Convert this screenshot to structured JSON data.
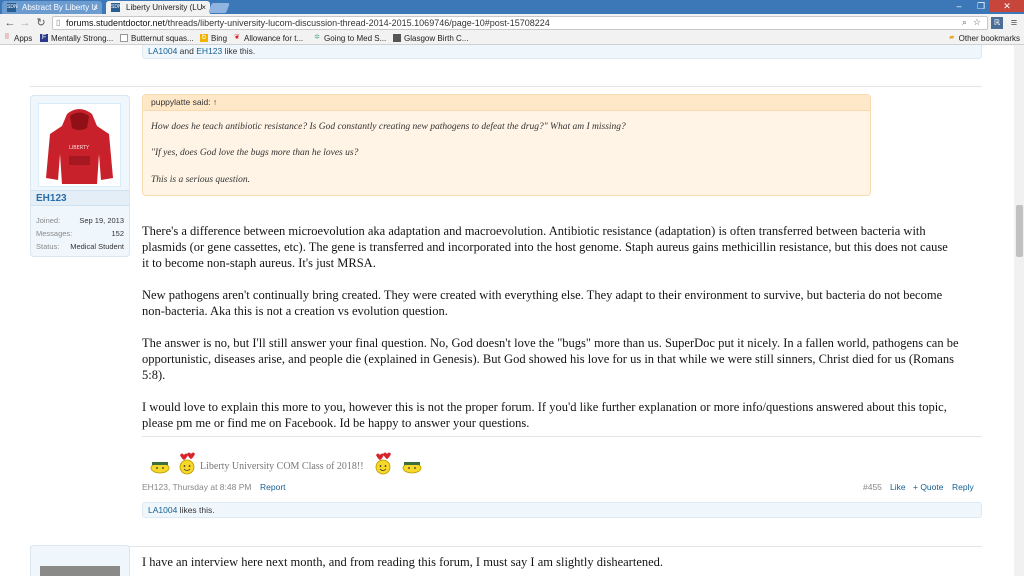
{
  "browser": {
    "tabs": [
      {
        "label": "Abstract By Liberty U",
        "active": false
      },
      {
        "label": "Liberty University (LU",
        "active": true
      }
    ],
    "url_prefix": "forums.studentdoctor.net",
    "url_path": "/threads/liberty-university-lucom-discussion-thread-2014-2015.1069746/page-10#post-15708224",
    "bookmarks": [
      {
        "label": "Apps",
        "icon": "apps-grid-icon"
      },
      {
        "label": "Mentally Strong...",
        "icon": "f-icon"
      },
      {
        "label": "Butternut squas...",
        "icon": "page-icon"
      },
      {
        "label": "Bing",
        "icon": "bing-icon"
      },
      {
        "label": "Allowance for t...",
        "icon": "leaf-icon"
      },
      {
        "label": "Going to Med S...",
        "icon": "sparkle-icon"
      },
      {
        "label": "Glasgow Birth C...",
        "icon": "page-icon"
      }
    ],
    "other_bookmarks": "Other bookmarks",
    "colors": {
      "tabbar": "#3c78b8",
      "close": "#c7453b"
    }
  },
  "prev_post": {
    "likers": [
      "LA1004",
      "EH123"
    ],
    "and_text": " and ",
    "like_suffix": " like this."
  },
  "post": {
    "author": {
      "username": "EH123",
      "joined_label": "Joined:",
      "joined_value": "Sep 19, 2013",
      "messages_label": "Messages:",
      "messages_value": "152",
      "status_label": "Status:",
      "status_value": "Medical Student"
    },
    "quote": {
      "header": "puppylatte said: ↑",
      "lines": [
        "How does he teach antibiotic resistance? Is God constantly creating new pathogens to defeat the drug?\" What am I missing?",
        "\"If yes, does God love the bugs more than he loves us?",
        "This is a serious question."
      ]
    },
    "paragraphs": [
      [
        "There's a difference between microevolution aka adaptation and macroevolution. Antibiotic resistance (adaptation) is often transferred between bacteria with",
        "plasmids (or gene cassettes, etc). The gene is transferred and incorporated into the host genome. Staph aureus gains methicillin resistance, but this does not cause",
        "it to become non-staph aureus. It's just MRSA."
      ],
      [
        "New pathogens aren't continually bring created. They were created with everything else. They adapt to their environment to survive, but bacteria do not become",
        "non-bacteria. Aka this is not a creation vs evolution question."
      ],
      [
        "The answer is no, but I'll still answer your final question. No, God doesn't love the \"bugs\" more than us. SuperDoc put it nicely. In a fallen world, pathogens can be",
        "opportunistic, diseases arise, and people die (explained in Genesis). But God showed his love for us in that while we were still sinners, Christ died for us (Romans",
        "5:8)."
      ],
      [
        "I would love to explain this more to you, however this is not the proper forum. If you'd like further explanation or more info/questions answered about this topic,",
        "please pm me or find me on Facebook. Id be happy to answer your questions."
      ]
    ],
    "signature": "Liberty University COM Class of 2018!!",
    "meta": {
      "byline": "EH123, Thursday at 8:48 PM",
      "report": "Report",
      "post_number": "#455",
      "like": "Like",
      "quote": "+ Quote",
      "reply": "Reply"
    },
    "likes": {
      "liker": "LA1004",
      "suffix": " likes this."
    }
  },
  "next_post": {
    "first_line": "I have an interview here next month, and from reading this forum, I must say I am slightly disheartened."
  }
}
